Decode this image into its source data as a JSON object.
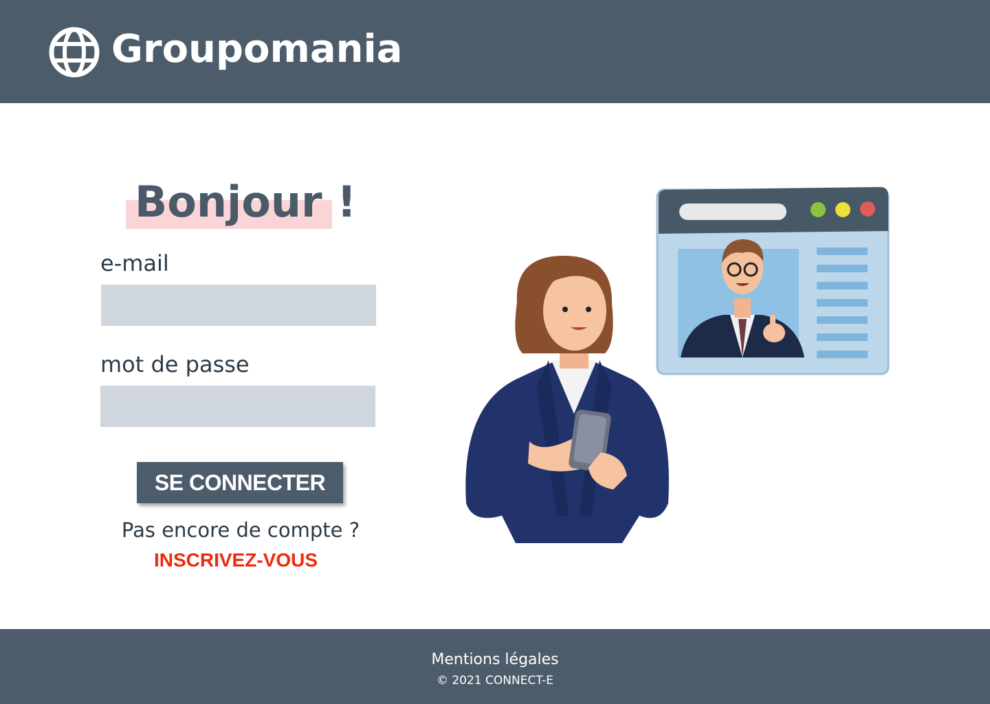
{
  "header": {
    "brand": "Groupomania",
    "logo_icon": "globe-icon",
    "background_color": "#4d5c6a"
  },
  "login": {
    "greeting": "Bonjour !",
    "email_label": "e-mail",
    "email_value": "",
    "password_label": "mot de passe",
    "password_value": "",
    "submit_label": "SE CONNECTER",
    "no_account_text": "Pas encore de compte ?",
    "signup_link": "INSCRIVEZ-VOUS",
    "accent_color": "#ee2a0b",
    "highlight_color": "#fbd4d7"
  },
  "illustration": {
    "subject": "woman-with-phone-and-video-call-window"
  },
  "footer": {
    "legal_link": "Mentions légales",
    "copyright": "© 2021 CONNECT-E"
  }
}
